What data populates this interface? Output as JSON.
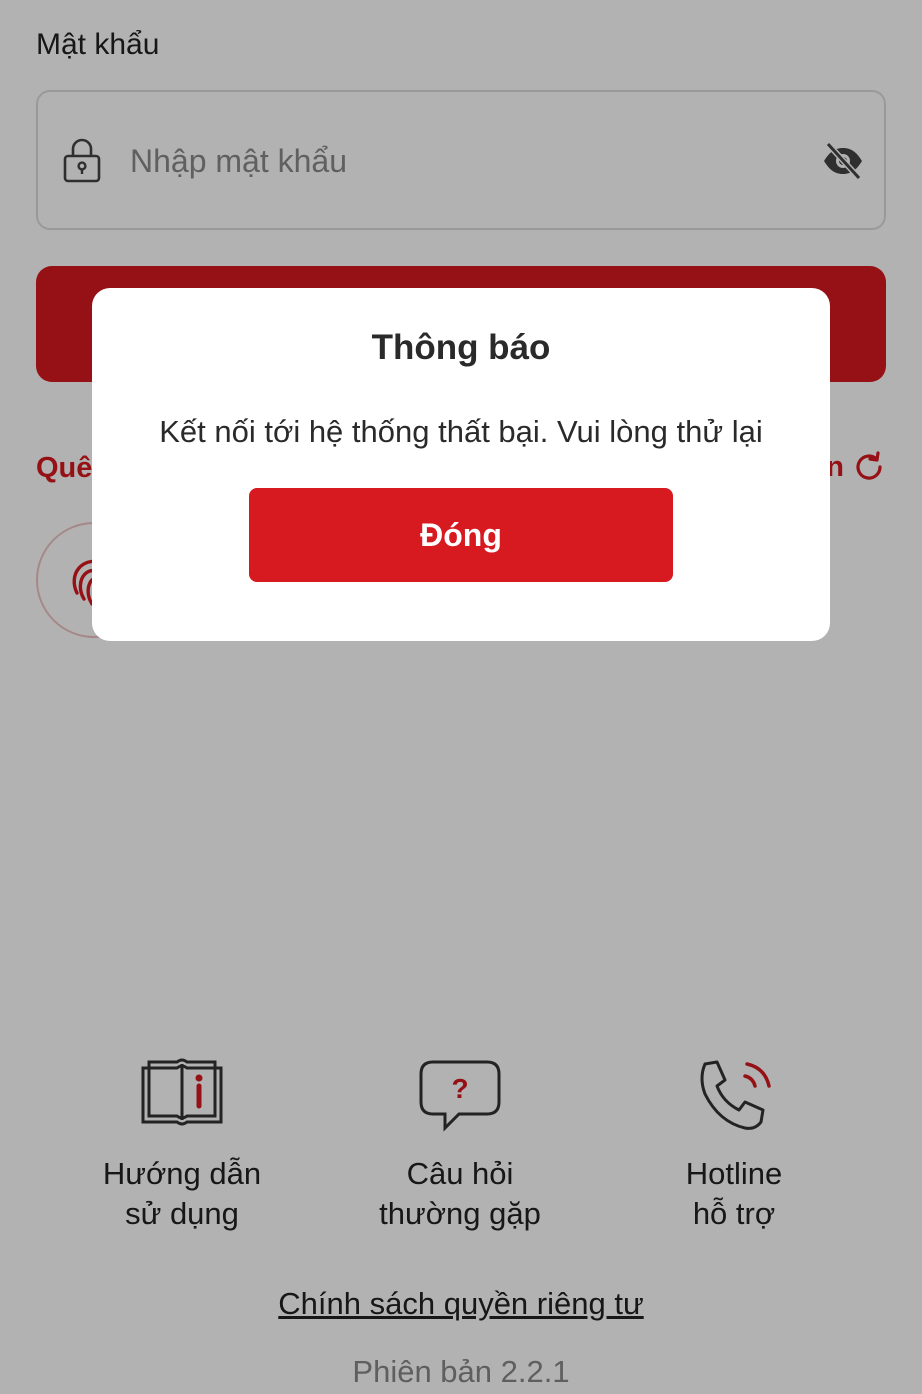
{
  "login": {
    "password_label": "Mật khẩu",
    "password_placeholder": "Nhập mật khẩu",
    "forgot_prefix": "Quê",
    "refresh_suffix": "n"
  },
  "help": {
    "guide": {
      "line1": "Hướng dẫn",
      "line2": "sử dụng"
    },
    "faq": {
      "line1": "Câu hỏi",
      "line2": "thường gặp"
    },
    "hotline": {
      "line1": "Hotline",
      "line2": "hỗ trợ"
    }
  },
  "footer": {
    "privacy": "Chính sách quyền riêng tư",
    "version": "Phiên bản 2.2.1"
  },
  "dialog": {
    "title": "Thông báo",
    "message": "Kết nối tới hệ thống thất bại. Vui lòng thử lại",
    "close_label": "Đóng"
  },
  "colors": {
    "accent": "#d71920",
    "overlay": "rgba(0,0,0,0.3)"
  },
  "icons": {
    "lock": "lock-icon",
    "eye": "eye-off-icon",
    "refresh": "refresh-icon",
    "fingerprint": "fingerprint-icon",
    "guide": "book-info-icon",
    "faq": "question-bubble-icon",
    "hotline": "phone-ringing-icon"
  }
}
